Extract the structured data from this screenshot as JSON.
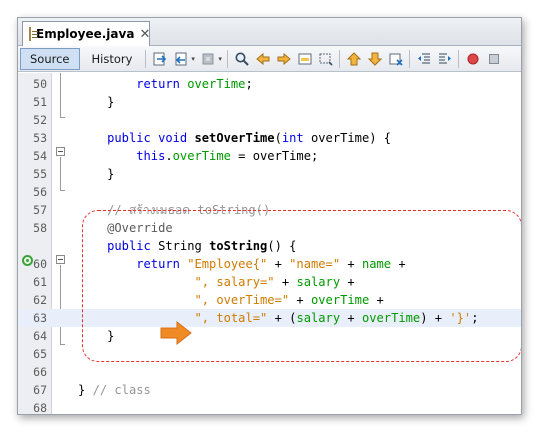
{
  "tab": {
    "title": "Employee.java",
    "close": "✕"
  },
  "toolbar": {
    "source_label": "Source",
    "history_label": "History",
    "icons": [
      "last-edit-icon",
      "back-icon",
      "forward-icon",
      "find-icon",
      "find-prev-icon",
      "find-next-icon",
      "toggle-highlight-icon",
      "toggle-rect-select-icon",
      "prev-bookmark-icon",
      "next-bookmark-icon",
      "toggle-bookmark-icon",
      "shift-left-icon",
      "shift-right-icon",
      "record-macro-icon",
      "stop-macro-icon"
    ]
  },
  "annotation": {
    "box_color": "#e63030",
    "arrow_color": "#f08a24"
  },
  "lines": [
    {
      "num": "50",
      "tokens": [
        [
          "        ",
          ""
        ],
        [
          "return",
          "kw"
        ],
        [
          " ",
          ""
        ],
        [
          "overTime",
          "fld"
        ],
        [
          ";",
          ""
        ]
      ]
    },
    {
      "num": "51",
      "tokens": [
        [
          "    }",
          ""
        ]
      ]
    },
    {
      "num": "52",
      "tokens": [
        [
          "",
          ""
        ]
      ]
    },
    {
      "num": "53",
      "tokens": [
        [
          "    ",
          ""
        ],
        [
          "public",
          "kw"
        ],
        [
          " ",
          ""
        ],
        [
          "void",
          "kw"
        ],
        [
          " ",
          ""
        ],
        [
          "setOverTime",
          "mth"
        ],
        [
          "(",
          ""
        ],
        [
          "int",
          "kw"
        ],
        [
          " overTime) {",
          ""
        ]
      ]
    },
    {
      "num": "54",
      "tokens": [
        [
          "        ",
          ""
        ],
        [
          "this",
          "kw"
        ],
        [
          ".",
          ""
        ],
        [
          "overTime",
          "fld"
        ],
        [
          " = overTime;",
          ""
        ]
      ]
    },
    {
      "num": "55",
      "tokens": [
        [
          "    }",
          ""
        ]
      ]
    },
    {
      "num": "56",
      "tokens": [
        [
          "",
          ""
        ]
      ]
    },
    {
      "num": "57",
      "tokens": [
        [
          "    ",
          ""
        ],
        [
          "// สร้างเมธอด toString()",
          "cmt"
        ]
      ]
    },
    {
      "num": "58",
      "tokens": [
        [
          "    ",
          ""
        ],
        [
          "@Override",
          "ann"
        ]
      ]
    },
    {
      "num": "",
      "tokens": [
        [
          "    ",
          ""
        ],
        [
          "public",
          "kw"
        ],
        [
          " String ",
          ""
        ],
        [
          "toString",
          "mth"
        ],
        [
          "() {",
          ""
        ]
      ]
    },
    {
      "num": "60",
      "tokens": [
        [
          "        ",
          ""
        ],
        [
          "return",
          "kw"
        ],
        [
          " ",
          ""
        ],
        [
          "\"Employee{\"",
          "str"
        ],
        [
          " + ",
          ""
        ],
        [
          "\"name=\"",
          "str"
        ],
        [
          " + ",
          ""
        ],
        [
          "name",
          "fld"
        ],
        [
          " +",
          ""
        ]
      ]
    },
    {
      "num": "61",
      "tokens": [
        [
          "                ",
          ""
        ],
        [
          "\", salary=\"",
          "str"
        ],
        [
          " + ",
          ""
        ],
        [
          "salary",
          "fld"
        ],
        [
          " +",
          ""
        ]
      ]
    },
    {
      "num": "62",
      "tokens": [
        [
          "                ",
          ""
        ],
        [
          "\", overTime=\"",
          "str"
        ],
        [
          " + ",
          ""
        ],
        [
          "overTime",
          "fld"
        ],
        [
          " +",
          ""
        ]
      ]
    },
    {
      "num": "63",
      "tokens": [
        [
          "                ",
          ""
        ],
        [
          "\", total=\"",
          "str"
        ],
        [
          " + (",
          ""
        ],
        [
          "salary",
          "fld"
        ],
        [
          " + ",
          ""
        ],
        [
          "overTime",
          "fld"
        ],
        [
          ") + ",
          ""
        ],
        [
          "'}'",
          "str"
        ],
        [
          ";",
          ""
        ]
      ]
    },
    {
      "num": "64",
      "tokens": [
        [
          "    }",
          ""
        ]
      ]
    },
    {
      "num": "65",
      "tokens": [
        [
          "",
          ""
        ]
      ]
    },
    {
      "num": "66",
      "tokens": [
        [
          "",
          ""
        ]
      ]
    },
    {
      "num": "67",
      "tokens": [
        [
          "",
          ""
        ],
        [
          "}",
          ""
        ],
        [
          " ",
          ""
        ],
        [
          "// class",
          "cmt"
        ]
      ]
    },
    {
      "num": "68",
      "tokens": [
        [
          "",
          ""
        ]
      ]
    }
  ]
}
